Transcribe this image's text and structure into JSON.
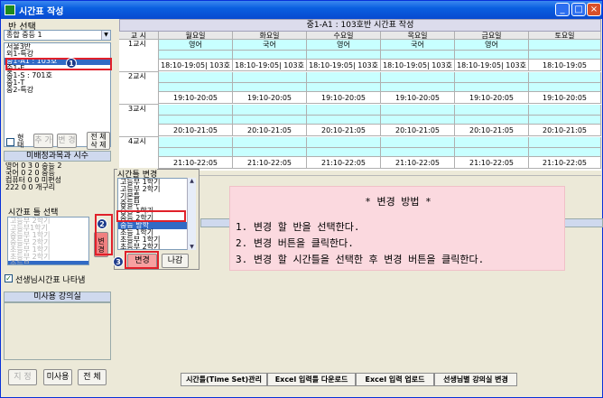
{
  "window": {
    "title": "시간표 작성"
  },
  "left": {
    "class_select_label": "반 선택",
    "class_combo": "종합 중등 1",
    "class_list": [
      "서울3반",
      "외1-특강",
      "중1-A1 : 103호",
      "중1-E",
      "중1-S : 701호",
      "중1-T",
      "중2-특강"
    ],
    "class_list_selected": 2,
    "chk_label": "형태",
    "btn_add": "추 가",
    "btn_change": "변 경",
    "btn_delete_all": "전 체 삭 제",
    "unassigned_header": "미배정과목과 시수",
    "unassigned_list": [
      "영어 0 3 0 중등 2",
      "국어 0 2 0 중등",
      "컴퓨터 0 0 미편성",
      "222 0 0 개구리"
    ],
    "timeset_label": "시간표 틀 선택",
    "timeset_list": [
      "고등부 2학기",
      "고등부1학기",
      "중등부 1학기",
      "중등부 2학기",
      "초등부 1학기",
      "초등부 2학기",
      "중등부"
    ],
    "timeset_selected": 6,
    "change_vertical_btn": "변경",
    "teacher_chk": "선생님시간표 나타냄",
    "unused_room_header": "미사용 강의실",
    "btn_assign": "지 정",
    "btn_unused": "미사용",
    "btn_all": "전 체"
  },
  "main": {
    "table_title": "중1-A1 : 103호반 시간표 작성",
    "headers": [
      "교 시",
      "월요일",
      "화요일",
      "수요일",
      "목요일",
      "금요일",
      "토요일"
    ],
    "periods": [
      {
        "label": "1교시",
        "subjects": [
          "영어",
          "국어",
          "영어",
          "국어",
          "영어",
          ""
        ],
        "times": [
          "18:10-19:05| 103호",
          "18:10-19:05| 103호",
          "18:10-19:05| 103호",
          "18:10-19:05| 103호",
          "18:10-19:05| 103호",
          "18:10-19:05"
        ]
      },
      {
        "label": "2교시",
        "subjects": [
          "",
          "",
          "",
          "",
          "",
          ""
        ],
        "times": [
          "19:10-20:05",
          "19:10-20:05",
          "19:10-20:05",
          "19:10-20:05",
          "19:10-20:05",
          "19:10-20:05"
        ]
      },
      {
        "label": "3교시",
        "subjects": [
          "",
          "",
          "",
          "",
          "",
          ""
        ],
        "times": [
          "20:10-21:05",
          "20:10-21:05",
          "20:10-21:05",
          "20:10-21:05",
          "20:10-21:05",
          "20:10-21:05"
        ]
      },
      {
        "label": "4교시",
        "subjects": [
          "",
          "",
          "",
          "",
          "",
          ""
        ],
        "times": [
          "21:10-22:05",
          "21:10-22:05",
          "21:10-22:05",
          "21:10-22:05",
          "21:10-22:05",
          "21:10-22:05"
        ]
      }
    ],
    "info_title": "* 변경 방법 *",
    "info_lines": [
      "1. 변경 할 반을 선택한다.",
      "2. 변경 버튼을 클릭한다.",
      "3. 변경 할 시간틀을 선택한 후 변경 버튼을 클릭한다."
    ],
    "bottom_buttons": [
      "시간틀(Time Set)관리",
      "Excel 입력틀 다운로드",
      "Excel 입력 업로드",
      "선생님별 강의실 변경"
    ]
  },
  "popup": {
    "title": "시간틀 변경",
    "list": [
      "고등부 1학기",
      "고등부 2학기",
      "기본틀",
      "중등부",
      "중등 1학기",
      "중등 2학기",
      "중등 방학",
      "초등 1학기",
      "초등부 1학기",
      "초등부 2학기",
      "초등부"
    ],
    "selected": 6,
    "btn_change": "변경",
    "btn_exit": "나감"
  },
  "badges": [
    "1",
    "2",
    "3"
  ],
  "colors": {
    "titlebar": "#0a5fe0",
    "cyan_cell": "#c8ffff",
    "info_bg": "#fbd9df",
    "highlight": "#e0202a",
    "selection": "#316ac5"
  }
}
